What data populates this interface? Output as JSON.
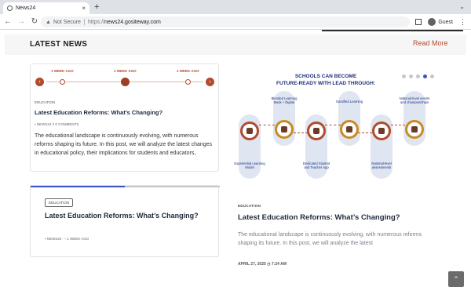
{
  "browser": {
    "tab_title": "News24",
    "tab_close": "×",
    "new_tab": "+",
    "tab_menu": "⌄",
    "not_secure": "Not Secure",
    "url_proto": "https://",
    "url_host": "news24.gositeway.com",
    "profile_label": "Guest"
  },
  "section": {
    "title": "LATEST NEWS",
    "read_more": "Read More"
  },
  "card1": {
    "timeline": [
      "1 WEEK AGO",
      "1 WEEK AGO",
      "1 WEEK AGO"
    ],
    "category": "EDUCATION",
    "title": "Latest Education Reforms: What’s Changing?",
    "author": "NEWS24",
    "comments": "0 COMMENTS",
    "excerpt": "The educational landscape is continuously evolving, with numerous reforms shaping its future. In this post, we will analyze the latest changes in educational policy, their implications for students and educators,"
  },
  "card2": {
    "progress": 0.5,
    "badge": "EDUCATION",
    "title": "Latest Education Reforms: What’s Changing?",
    "author": "NEWS24",
    "time": "1 WEEK AGO"
  },
  "promo": {
    "title_line1": "SCHOOLS CAN BECOME",
    "title_line2": "FUTURE-READY WITH LEAD THROUGH:",
    "active_dot": 3,
    "labels": [
      "Experiential Learning Model",
      "Blended Learning Book + Digital",
      "Dedicated Student and Teacher App",
      "Gamified Learning",
      "National-level assessments",
      "National-level events and championships"
    ]
  },
  "feature": {
    "category": "EDUCATION",
    "title": "Latest Education Reforms: What’s Changing?",
    "excerpt": "The educational landscape is continuously evolving, with numerous reforms shaping its future. In this post, we will analyze the latest",
    "date": "APRIL 27, 2025",
    "time": "7:24 AM"
  },
  "colors": {
    "accent": "#b24b2d",
    "navy": "#1d2d7a",
    "progress": "#3a53c5"
  }
}
